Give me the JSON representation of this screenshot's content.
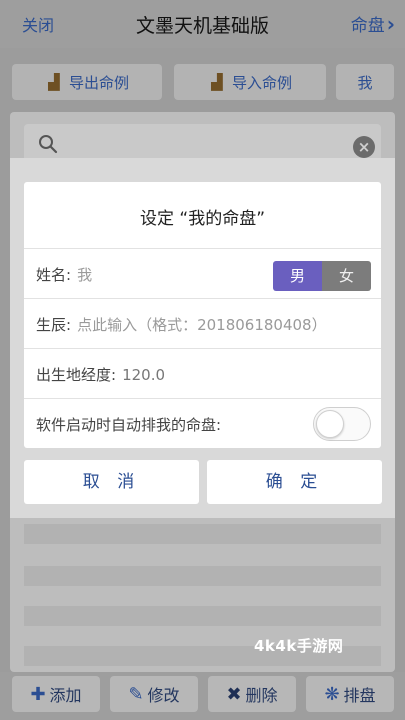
{
  "topbar": {
    "left": "关闭",
    "title": "文墨天机基础版",
    "right": "命盘"
  },
  "toolbar": {
    "export_label": "导出命例",
    "import_label": "导入命例",
    "mine_label": "我"
  },
  "dialog": {
    "title": "设定 “我的命盘”",
    "name_label": "姓名:",
    "name_value": "我",
    "gender_male": "男",
    "gender_female": "女",
    "gender_selected": "男",
    "birth_label": "生辰:",
    "birth_placeholder": "点此输入（格式：201806180408）",
    "longitude_label": "出生地经度:",
    "longitude_value": "120.0",
    "auto_label": "软件启动时自动排我的命盘:",
    "auto_enabled": false,
    "cancel_label": "取 消",
    "ok_label": "确 定"
  },
  "bottom": {
    "add_label": "添加",
    "edit_label": "修改",
    "delete_label": "删除",
    "sort_label": "排盘"
  },
  "watermark": "4k4k手游网",
  "colors": {
    "accent": "#2b4e93",
    "male_selected": "#6a5fbf",
    "female_unselected": "#7c7c7c"
  },
  "icons": {
    "export": "export-icon",
    "import": "import-icon",
    "search": "search-icon",
    "clear": "clear-icon",
    "add": "plus-icon",
    "edit": "pencil-icon",
    "delete": "x-icon",
    "sort": "gear-icon"
  }
}
